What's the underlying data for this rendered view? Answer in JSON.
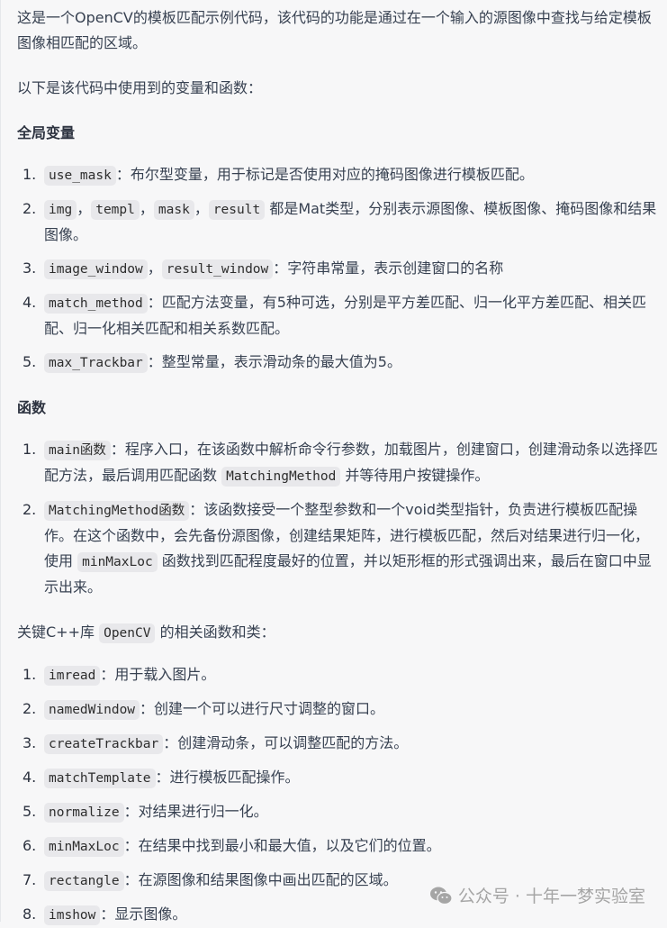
{
  "intro": "这是一个OpenCV的模板匹配示例代码，该代码的功能是通过在一个输入的源图像中查找与给定模板图像相匹配的区域。",
  "vars_intro": "以下是该代码中使用到的变量和函数：",
  "globals": {
    "heading": "全局变量",
    "items": [
      {
        "num": "1.",
        "codes": [
          "use_mask"
        ],
        "seps": [],
        "text": "：布尔型变量，用于标记是否使用对应的掩码图像进行模板匹配。"
      },
      {
        "num": "2.",
        "codes": [
          "img",
          "templ",
          "mask",
          "result"
        ],
        "seps": [
          "，",
          "，",
          "，"
        ],
        "text": "都是Mat类型，分别表示源图像、模板图像、掩码图像和结果图像。"
      },
      {
        "num": "3.",
        "codes": [
          "image_window",
          "result_window"
        ],
        "seps": [
          "，"
        ],
        "text": "：字符串常量，表示创建窗口的名称"
      },
      {
        "num": "4.",
        "codes": [
          "match_method"
        ],
        "seps": [],
        "text": "：匹配方法变量，有5种可选，分别是平方差匹配、归一化平方差匹配、相关匹配、归一化相关匹配和相关系数匹配。"
      },
      {
        "num": "5.",
        "codes": [
          "max_Trackbar"
        ],
        "seps": [],
        "text": "：整型常量，表示滑动条的最大值为5。"
      }
    ]
  },
  "functions": {
    "heading": "函数",
    "items": [
      {
        "num": "1.",
        "code": "main函数",
        "text_before": "：程序入口，在该函数中解析命令行参数，加载图片，创建窗口，创建滑动条以选择匹配方法，最后调用匹配函数",
        "inline_code": "MatchingMethod",
        "text_after": "并等待用户按键操作。"
      },
      {
        "num": "2.",
        "code": "MatchingMethod函数",
        "text_before": "：该函数接受一个整型参数和一个void类型指针，负责进行模板匹配操作。在这个函数中，会先备份源图像，创建结果矩阵，进行模板匹配，然后对结果进行归一化，使用",
        "inline_code": "minMaxLoc",
        "text_after": "函数找到匹配程度最好的位置，并以矩形框的形式强调出来，最后在窗口中显示出来。"
      }
    ]
  },
  "lib_intro": {
    "before": "关键C++库",
    "code": "OpenCV",
    "after": "的相关函数和类："
  },
  "library": {
    "items": [
      {
        "num": "1.",
        "code": "imread",
        "text": "：用于载入图片。"
      },
      {
        "num": "2.",
        "code": "namedWindow",
        "text": "：创建一个可以进行尺寸调整的窗口。"
      },
      {
        "num": "3.",
        "code": "createTrackbar",
        "text": "：创建滑动条，可以调整匹配的方法。"
      },
      {
        "num": "4.",
        "code": "matchTemplate",
        "text": "：进行模板匹配操作。"
      },
      {
        "num": "5.",
        "code": "normalize",
        "text": "：对结果进行归一化。"
      },
      {
        "num": "6.",
        "code": "minMaxLoc",
        "text": "：在结果中找到最小和最大值，以及它们的位置。"
      },
      {
        "num": "7.",
        "code": "rectangle",
        "text": "：在源图像和结果图像中画出匹配的区域。"
      },
      {
        "num": "8.",
        "code": "imshow",
        "text": "：显示图像。"
      }
    ]
  },
  "watermark": {
    "icon": "wechat-icon",
    "text": "公众号 · 十年一梦实验室"
  }
}
